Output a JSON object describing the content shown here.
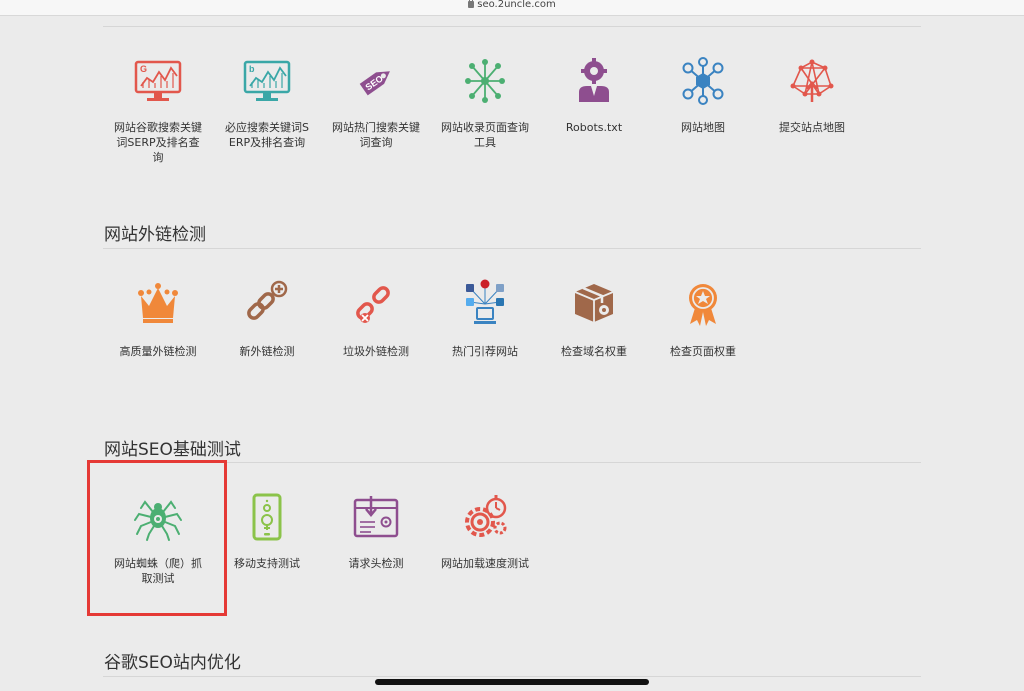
{
  "browser": {
    "url": "seo.2uncle.com"
  },
  "sections": [
    {
      "title": "",
      "tools": [
        {
          "label": "网站谷歌搜索关键词SERP及排名查询",
          "icon": "google-serp-chart-icon"
        },
        {
          "label": "必应搜索关键词SERP及排名查询",
          "icon": "bing-serp-chart-icon"
        },
        {
          "label": "网站热门搜索关键词查询",
          "icon": "seo-tag-icon"
        },
        {
          "label": "网站收录页面查询工具",
          "icon": "indexed-pages-network-icon"
        },
        {
          "label": "Robots.txt",
          "icon": "robot-gear-icon"
        },
        {
          "label": "网站地图",
          "icon": "sitemap-hexagon-icon"
        },
        {
          "label": "提交站点地图",
          "icon": "submit-sitemap-icon"
        }
      ]
    },
    {
      "title": "网站外链检测",
      "tools": [
        {
          "label": "高质量外链检测",
          "icon": "crown-icon"
        },
        {
          "label": "新外链检测",
          "icon": "add-link-icon"
        },
        {
          "label": "垃圾外链检测",
          "icon": "remove-link-icon"
        },
        {
          "label": "热门引荐网站",
          "icon": "social-referrer-icon"
        },
        {
          "label": "检查域名权重",
          "icon": "domain-box-gear-icon"
        },
        {
          "label": "检查页面权重",
          "icon": "page-rank-badge-icon"
        }
      ]
    },
    {
      "title": "网站SEO基础测试",
      "tools": [
        {
          "label": "网站蜘蛛（爬）抓取测试",
          "icon": "spider-icon"
        },
        {
          "label": "移动支持测试",
          "icon": "mobile-support-icon"
        },
        {
          "label": "请求头检测",
          "icon": "request-header-icon"
        },
        {
          "label": "网站加载速度测试",
          "icon": "speed-gears-icon"
        }
      ]
    },
    {
      "title": "谷歌SEO站内优化",
      "tools": []
    }
  ],
  "colors": {
    "red": "#e2574c",
    "teal": "#3aa7a7",
    "purple": "#8e4e8f",
    "green": "#4caf72",
    "orange": "#f0883a",
    "brown": "#a0684a",
    "blue": "#3a83c1",
    "lime": "#8bc34a",
    "highlight": "#e53935"
  }
}
